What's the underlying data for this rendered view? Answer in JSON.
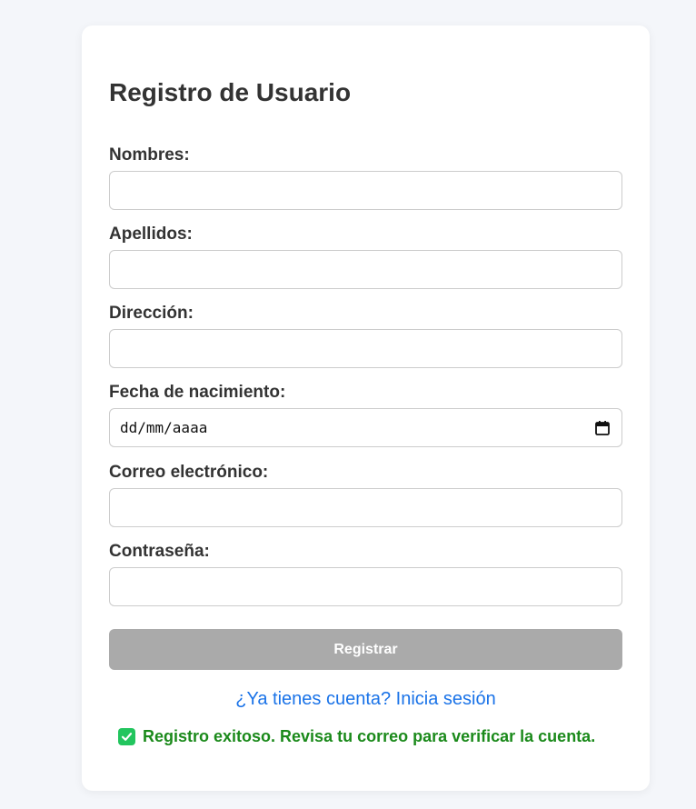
{
  "form": {
    "title": "Registro de Usuario",
    "fields": [
      {
        "label": "Nombres:",
        "value": ""
      },
      {
        "label": "Apellidos:",
        "value": ""
      },
      {
        "label": "Dirección:",
        "value": ""
      },
      {
        "label": "Fecha de nacimiento:",
        "value": "dd/mm/aaaa"
      },
      {
        "label": "Correo electrónico:",
        "value": ""
      },
      {
        "label": "Contraseña:",
        "value": ""
      }
    ],
    "submit_label": "Registrar",
    "login_link": "¿Ya tienes cuenta? Inicia sesión",
    "success_message": "Registro exitoso. Revisa tu correo para verificar la cuenta."
  },
  "colors": {
    "background": "#f4f6fa",
    "button_disabled": "#aaaaaa",
    "link": "#1a73e8",
    "success": "#1b8a1b",
    "check_badge": "#22c55e"
  },
  "icons": [
    "calendar-icon",
    "check-icon"
  ]
}
